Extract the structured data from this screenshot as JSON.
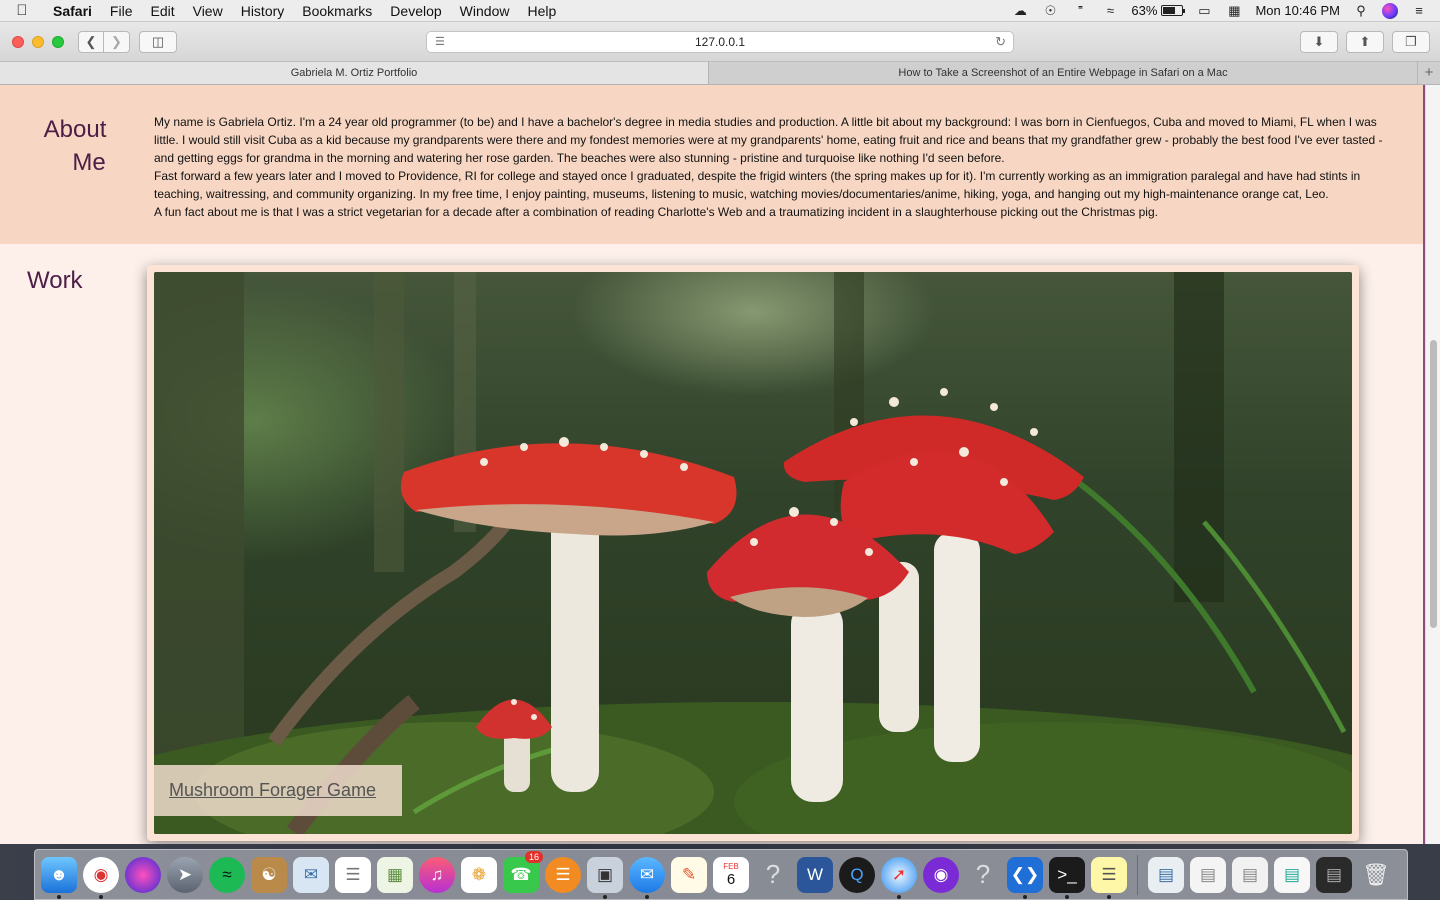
{
  "menubar": {
    "app": "Safari",
    "items": [
      "File",
      "Edit",
      "View",
      "History",
      "Bookmarks",
      "Develop",
      "Window",
      "Help"
    ],
    "battery": "63%",
    "battery_level": 0.63,
    "clock": "Mon 10:46 PM"
  },
  "toolbar": {
    "url": "127.0.0.1"
  },
  "tabs": [
    {
      "title": "Gabriela M. Ortiz Portfolio",
      "active": true
    },
    {
      "title": "How to Take a Screenshot of an Entire Webpage in Safari on a Mac",
      "active": false
    }
  ],
  "page": {
    "about_title_1": "About",
    "about_title_2": "Me",
    "about_p1": "My name is Gabriela Ortiz. I'm a 24 year old programmer (to be) and I have a bachelor's degree in media studies and production. A little bit about my background: I was born in Cienfuegos, Cuba and moved to Miami, FL when I was little. I would still visit Cuba as a kid because my grandparents were there and my fondest memories were at my grandparents' home, eating fruit and rice and beans that my grandfather grew - probably the best food I've ever tasted - and getting eggs for grandma in the morning and watering her rose garden. The beaches were also stunning - pristine and turquoise like nothing I'd seen before.",
    "about_p2": "Fast forward a few years later and I moved to Providence, RI for college and stayed once I graduated, despite the frigid winters (the spring makes up for it). I'm currently working as an immigration paralegal and have had stints in teaching, waitressing, and community organizing. In my free time, I enjoy painting, museums, listening to music, watching movies/documentaries/anime, hiking, yoga, and hanging out my high-maintenance orange cat, Leo.",
    "about_p3": "A fun fact about me is that I was a strict vegetarian for a decade after a combination of reading Charlotte's Web and a traumatizing incident in a slaughterhouse picking out the Christmas pig.",
    "work_title": "Work",
    "work_link": "Mushroom Forager Game"
  },
  "dock": {
    "messages_badge": "16",
    "calendar_month": "FEB",
    "calendar_day": "6"
  }
}
